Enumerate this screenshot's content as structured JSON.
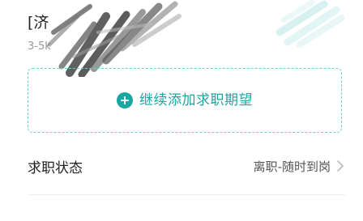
{
  "job_card": {
    "title": "[济",
    "salary": "3-5k"
  },
  "add_expectation": {
    "label": "继续添加求职期望",
    "icon": "plus-circle-icon"
  },
  "status_row": {
    "title": "求职状态",
    "value": "离职-随时到岗",
    "icon": "chevron-right-icon"
  },
  "colors": {
    "accent": "#1aa7a1",
    "dashed_border": "#6fcfc9"
  }
}
